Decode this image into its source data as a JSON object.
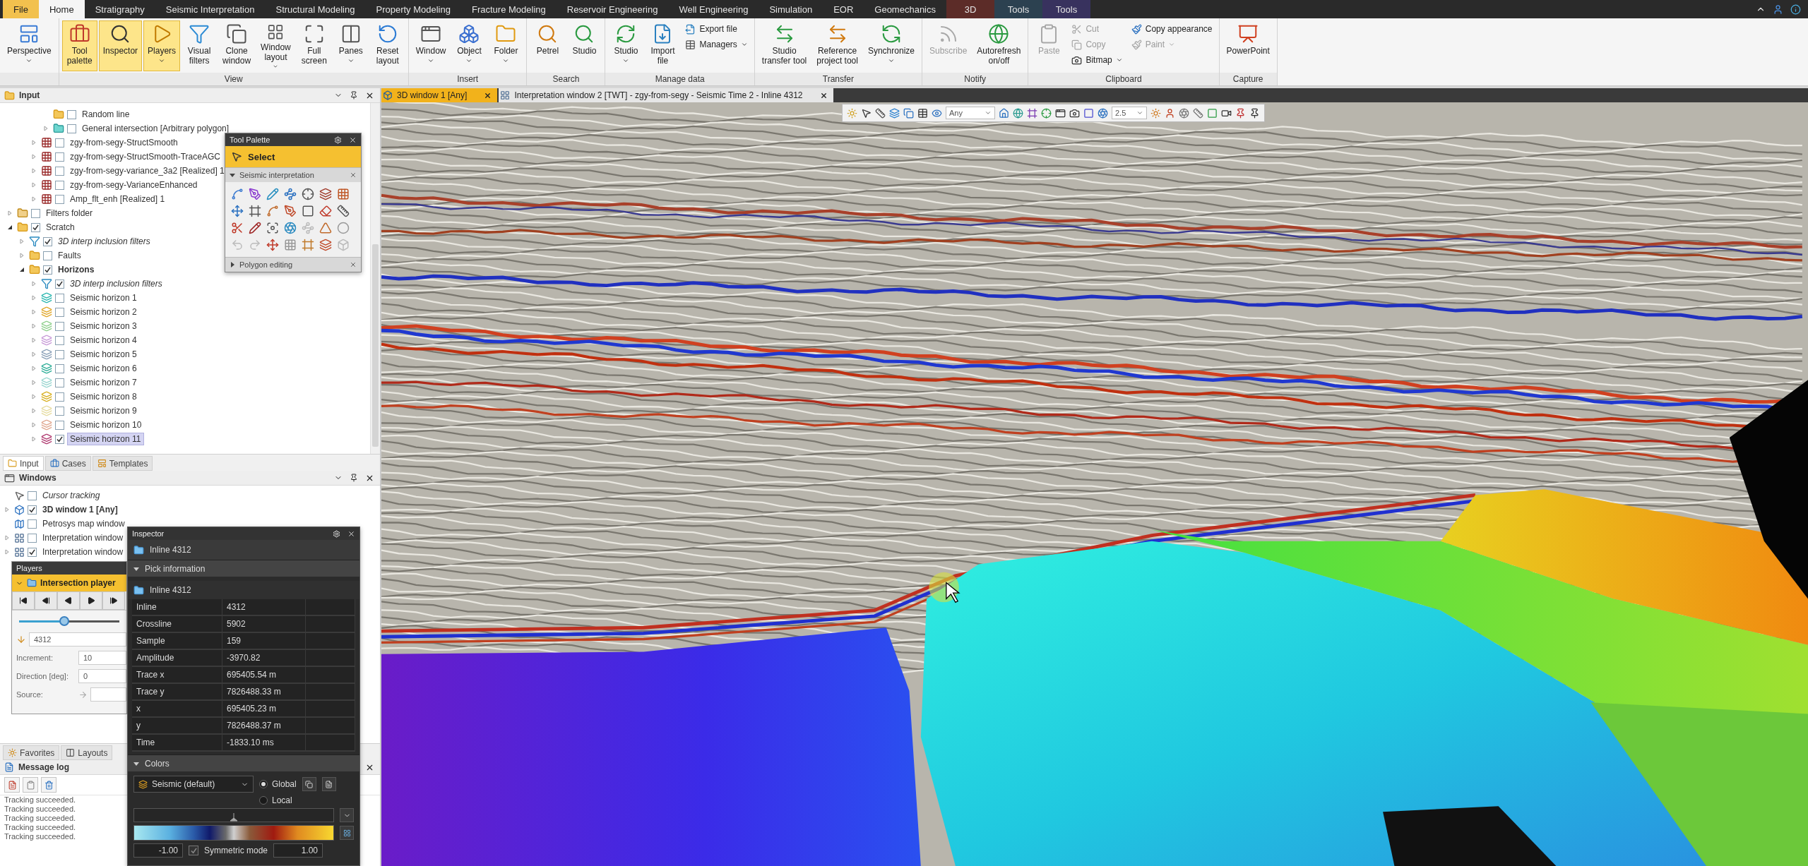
{
  "ribbon": {
    "tabs": [
      {
        "label": "File",
        "kind": "file",
        "selected": false
      },
      {
        "label": "Home",
        "kind": "normal",
        "selected": true
      },
      {
        "label": "Stratigraphy",
        "kind": "normal",
        "selected": false
      },
      {
        "label": "Seismic Interpretation",
        "kind": "normal",
        "selected": false
      },
      {
        "label": "Structural Modeling",
        "kind": "normal",
        "selected": false
      },
      {
        "label": "Property Modeling",
        "kind": "normal",
        "selected": false
      },
      {
        "label": "Fracture Modeling",
        "kind": "normal",
        "selected": false
      },
      {
        "label": "Reservoir Engineering",
        "kind": "normal",
        "selected": false
      },
      {
        "label": "Well Engineering",
        "kind": "normal",
        "selected": false
      },
      {
        "label": "Simulation",
        "kind": "normal",
        "selected": false
      },
      {
        "label": "EOR",
        "kind": "normal",
        "selected": false
      },
      {
        "label": "Geomechanics",
        "kind": "normal",
        "selected": false
      },
      {
        "label": "3D",
        "kind": "contextual",
        "color": "#5c2c28",
        "selected": false
      },
      {
        "label": "Tools",
        "kind": "contextual",
        "color": "#2c4150",
        "selected": false
      },
      {
        "label": "Tools",
        "kind": "contextual",
        "color": "#38325e",
        "selected": false
      }
    ],
    "groups": [
      {
        "buttons": [
          {
            "kind": "large",
            "label": "Perspective",
            "dropdown": true,
            "on": false,
            "disabled": false
          }
        ]
      },
      {
        "label": "View",
        "buttons": [
          {
            "kind": "large",
            "label": "Tool\npalette",
            "dropdown": false,
            "on": true,
            "disabled": false
          },
          {
            "kind": "large",
            "label": "Inspector",
            "dropdown": false,
            "on": true,
            "disabled": false
          },
          {
            "kind": "large",
            "label": "Players",
            "dropdown": true,
            "on": true,
            "disabled": false
          },
          {
            "kind": "large",
            "label": "Visual\nfilters",
            "dropdown": false,
            "on": false,
            "disabled": false
          },
          {
            "kind": "large",
            "label": "Clone\nwindow",
            "dropdown": false,
            "on": false,
            "disabled": false
          },
          {
            "kind": "large",
            "label": "Window\nlayout",
            "dropdown": true,
            "on": false,
            "disabled": false
          },
          {
            "kind": "large",
            "label": "Full\nscreen",
            "dropdown": false,
            "on": false,
            "disabled": false
          },
          {
            "kind": "large",
            "label": "Panes",
            "dropdown": true,
            "on": false,
            "disabled": false
          },
          {
            "kind": "large",
            "label": "Reset\nlayout",
            "dropdown": false,
            "on": false,
            "disabled": false
          }
        ]
      },
      {
        "label": "Insert",
        "buttons": [
          {
            "kind": "large",
            "label": "Window",
            "dropdown": true,
            "on": false,
            "disabled": false
          },
          {
            "kind": "large",
            "label": "Object",
            "dropdown": true,
            "on": false,
            "disabled": false
          },
          {
            "kind": "large",
            "label": "Folder",
            "dropdown": true,
            "on": false,
            "disabled": false
          }
        ]
      },
      {
        "label": "Search",
        "buttons": [
          {
            "kind": "large",
            "label": "Petrel",
            "dropdown": false,
            "on": false,
            "disabled": false
          },
          {
            "kind": "large",
            "label": "Studio",
            "dropdown": false,
            "on": false,
            "disabled": false
          }
        ]
      },
      {
        "label": "Manage data",
        "buttons": [
          {
            "kind": "large",
            "label": "Studio",
            "dropdown": true,
            "on": false,
            "disabled": false
          },
          {
            "kind": "large",
            "label": "Import\nfile",
            "dropdown": false,
            "on": false,
            "disabled": false
          },
          {
            "kind": "stack",
            "buttons": [
              {
                "label": "Export file",
                "dropdown": false,
                "on": false,
                "disabled": false
              },
              {
                "label": "Managers",
                "dropdown": true,
                "on": false,
                "disabled": false
              }
            ]
          }
        ]
      },
      {
        "label": "Transfer",
        "buttons": [
          {
            "kind": "large",
            "label": "Studio\ntransfer tool",
            "dropdown": false,
            "on": false,
            "disabled": false
          },
          {
            "kind": "large",
            "label": "Reference\nproject tool",
            "dropdown": false,
            "on": false,
            "disabled": false
          },
          {
            "kind": "large",
            "label": "Synchronize",
            "dropdown": true,
            "on": false,
            "disabled": false
          }
        ]
      },
      {
        "label": "Notify",
        "buttons": [
          {
            "kind": "large",
            "label": "Subscribe",
            "dropdown": false,
            "on": false,
            "disabled": true
          },
          {
            "kind": "large",
            "label": "Autorefresh\non/off",
            "dropdown": false,
            "on": false,
            "disabled": false
          }
        ]
      },
      {
        "label": "Clipboard",
        "buttons": [
          {
            "kind": "large",
            "label": "Paste",
            "dropdown": false,
            "on": false,
            "disabled": true
          },
          {
            "kind": "stack",
            "buttons": [
              {
                "label": "Cut",
                "dropdown": false,
                "on": false,
                "disabled": true
              },
              {
                "label": "Copy",
                "dropdown": false,
                "on": false,
                "disabled": true
              },
              {
                "label": "Bitmap",
                "dropdown": true,
                "on": false,
                "disabled": false
              }
            ]
          },
          {
            "kind": "stack",
            "buttons": [
              {
                "label": "Copy appearance",
                "dropdown": false,
                "on": false,
                "disabled": false
              },
              {
                "label": "Paint",
                "dropdown": true,
                "on": false,
                "disabled": true
              }
            ]
          }
        ]
      },
      {
        "label": "Capture",
        "buttons": [
          {
            "kind": "large",
            "label": "PowerPoint",
            "dropdown": false,
            "on": false,
            "disabled": false
          }
        ]
      }
    ]
  },
  "input_panel": {
    "title": "Input",
    "tree": [
      {
        "children": [
          {
            "children": [
              {
                "children": [
                  {
                    "label": "Random line",
                    "kind": "folder",
                    "checked": false,
                    "selected": false,
                    "active": false
                  },
                  {
                    "label": "General intersection [Arbitrary polygon]",
                    "kind": "intersection",
                    "checked": false,
                    "selected": false,
                    "active": false,
                    "expanded": false
                  }
                ]
              },
              {
                "label": "zgy-from-segy-StructSmooth",
                "kind": "seismic",
                "checked": false,
                "selected": false,
                "active": false,
                "expanded": false
              },
              {
                "label": "zgy-from-segy-StructSmooth-TraceAGC",
                "kind": "seismic",
                "checked": false,
                "selected": false,
                "active": false,
                "expanded": false
              },
              {
                "label": "zgy-from-segy-variance_3a2 [Realized] 1",
                "kind": "seismic",
                "checked": false,
                "selected": false,
                "active": false,
                "expanded": false
              },
              {
                "label": "zgy-from-segy-VarianceEnhanced",
                "kind": "seismic",
                "checked": false,
                "selected": false,
                "active": false,
                "expanded": false
              },
              {
                "label": "Amp_flt_enh [Realized] 1",
                "kind": "seismic",
                "checked": false,
                "selected": false,
                "active": false,
                "expanded": false
              }
            ]
          }
        ]
      },
      {
        "label": "Filters folder",
        "kind": "filter_folder",
        "checked": false,
        "selected": false,
        "active": false,
        "expanded": false
      },
      {
        "label": "Scratch",
        "kind": "folder",
        "checked": true,
        "selected": false,
        "active": false,
        "expanded": true,
        "children": [
          {
            "label": "3D interp inclusion filters",
            "kind": "filter",
            "checked": true,
            "selected": false,
            "active": false,
            "expanded": false
          },
          {
            "label": "Faults",
            "kind": "folder",
            "checked": false,
            "selected": false,
            "active": false,
            "expanded": false
          },
          {
            "label": "Horizons",
            "kind": "folder",
            "checked": true,
            "selected": false,
            "active": true,
            "expanded": true,
            "children": [
              {
                "label": "3D interp inclusion filters",
                "kind": "filter",
                "checked": true,
                "selected": false,
                "active": false,
                "expanded": false
              },
              {
                "label": "Seismic horizon 1",
                "kind": "horizon",
                "color": "#2bb7b0",
                "checked": false,
                "selected": false,
                "active": false,
                "expanded": false
              },
              {
                "label": "Seismic horizon 2",
                "kind": "horizon",
                "color": "#e0a628",
                "checked": false,
                "selected": false,
                "active": false,
                "expanded": false
              },
              {
                "label": "Seismic horizon 3",
                "kind": "horizon",
                "color": "#8fd08c",
                "checked": false,
                "selected": false,
                "active": false,
                "expanded": false
              },
              {
                "label": "Seismic horizon 4",
                "kind": "horizon",
                "color": "#c89ad8",
                "checked": false,
                "selected": false,
                "active": false,
                "expanded": false
              },
              {
                "label": "Seismic horizon 5",
                "kind": "horizon",
                "color": "#8aa0b8",
                "checked": false,
                "selected": false,
                "active": false,
                "expanded": false
              },
              {
                "label": "Seismic horizon 6",
                "kind": "horizon",
                "color": "#2fae98",
                "checked": false,
                "selected": false,
                "active": false,
                "expanded": false
              },
              {
                "label": "Seismic horizon 7",
                "kind": "horizon",
                "color": "#9ad6d0",
                "checked": false,
                "selected": false,
                "active": false,
                "expanded": false
              },
              {
                "label": "Seismic horizon 8",
                "kind": "horizon",
                "color": "#d8b020",
                "checked": false,
                "selected": false,
                "active": false,
                "expanded": false
              },
              {
                "label": "Seismic horizon 9",
                "kind": "horizon",
                "color": "#e6dca0",
                "checked": false,
                "selected": false,
                "active": false,
                "expanded": false
              },
              {
                "label": "Seismic horizon 10",
                "kind": "horizon",
                "color": "#e0a890",
                "checked": false,
                "selected": false,
                "active": false,
                "expanded": false
              },
              {
                "label": "Seismic horizon 11",
                "kind": "horizon",
                "color": "#b03a70",
                "checked": true,
                "selected": true,
                "active": false,
                "expanded": false
              }
            ]
          }
        ]
      }
    ]
  },
  "explorer_tabs": [
    {
      "label": "Input",
      "selected": true
    },
    {
      "label": "Cases",
      "selected": false
    },
    {
      "label": "Templates",
      "selected": false
    }
  ],
  "windows_panel": {
    "title": "Windows",
    "items": [
      {
        "label": "Cursor tracking",
        "kind": "cursor",
        "checked": false,
        "active": false
      },
      {
        "label": "3D window 1 [Any]",
        "kind": "window_3d",
        "checked": true,
        "active": true,
        "expanded": false
      },
      {
        "label": "Petrosys map window",
        "kind": "map",
        "checked": false,
        "active": false
      },
      {
        "label": "Interpretation window",
        "kind": "interpretation",
        "checked": false,
        "active": false,
        "expanded": false
      },
      {
        "label": "Interpretation window",
        "kind": "interpretation",
        "checked": true,
        "active": false,
        "expanded": false
      }
    ]
  },
  "bottom_tabs": [
    {
      "label": "Favorites",
      "selected": false
    },
    {
      "label": "Layouts",
      "selected": false
    }
  ],
  "message_log": {
    "title": "Message log",
    "lines": [
      "Tracking succeeded.",
      "Tracking succeeded.",
      "Tracking succeeded.",
      "Tracking succeeded.",
      "Tracking succeeded."
    ]
  },
  "tool_palette": {
    "title": "Tool Palette",
    "tool": "Select",
    "sections": [
      {
        "label": "Seismic interpretation",
        "expanded": true
      },
      {
        "label": "Polygon editing",
        "expanded": false
      }
    ]
  },
  "players": {
    "title": "Players",
    "player": "Intersection player",
    "slider": {
      "level": 0.45
    },
    "value": "4312",
    "fields": [
      {
        "kind": "text",
        "label": "Increment:",
        "value": "10"
      },
      {
        "kind": "text",
        "label": "Direction [deg]:",
        "value": "0"
      },
      {
        "kind": "source",
        "label": "Source:"
      }
    ]
  },
  "inspector": {
    "title": "Inspector",
    "object": "Inline 4312",
    "pick_information": {
      "label": "Pick information",
      "expanded": true,
      "object": "Inline 4312",
      "rows": [
        {
          "name": "Inline",
          "value": "4312"
        },
        {
          "name": "Crossline",
          "value": "5902"
        },
        {
          "name": "Sample",
          "value": "159"
        },
        {
          "name": "Amplitude",
          "value": "-3970.82"
        },
        {
          "name": "Trace x",
          "value": "695405.54 m"
        },
        {
          "name": "Trace y",
          "value": "7826488.33 m"
        },
        {
          "name": "x",
          "value": "695405.23 m"
        },
        {
          "name": "y",
          "value": "7826488.37 m"
        },
        {
          "name": "Time",
          "value": "-1833.10 ms"
        }
      ]
    },
    "colors": {
      "label": "Colors",
      "expanded": true,
      "colormap": "Seismic (default)",
      "scope": [
        {
          "label": "Global",
          "selected": true
        },
        {
          "label": "Local",
          "selected": false
        }
      ],
      "min": "-1.00",
      "max": "1.00",
      "symmetric": {
        "label": "Symmetric mode",
        "checked": true
      }
    }
  },
  "viewport": {
    "tabs": [
      {
        "label": "3D window 1 [Any]",
        "kind": "window_3d",
        "selected": true
      },
      {
        "label": "Interpretation window 2 [TWT] - zgy-from-segy - Seismic Time 2 - Inline 4312",
        "kind": "interpretation",
        "selected": false
      }
    ],
    "toolbar": {
      "domain": "Any",
      "scale": "2.5"
    }
  }
}
